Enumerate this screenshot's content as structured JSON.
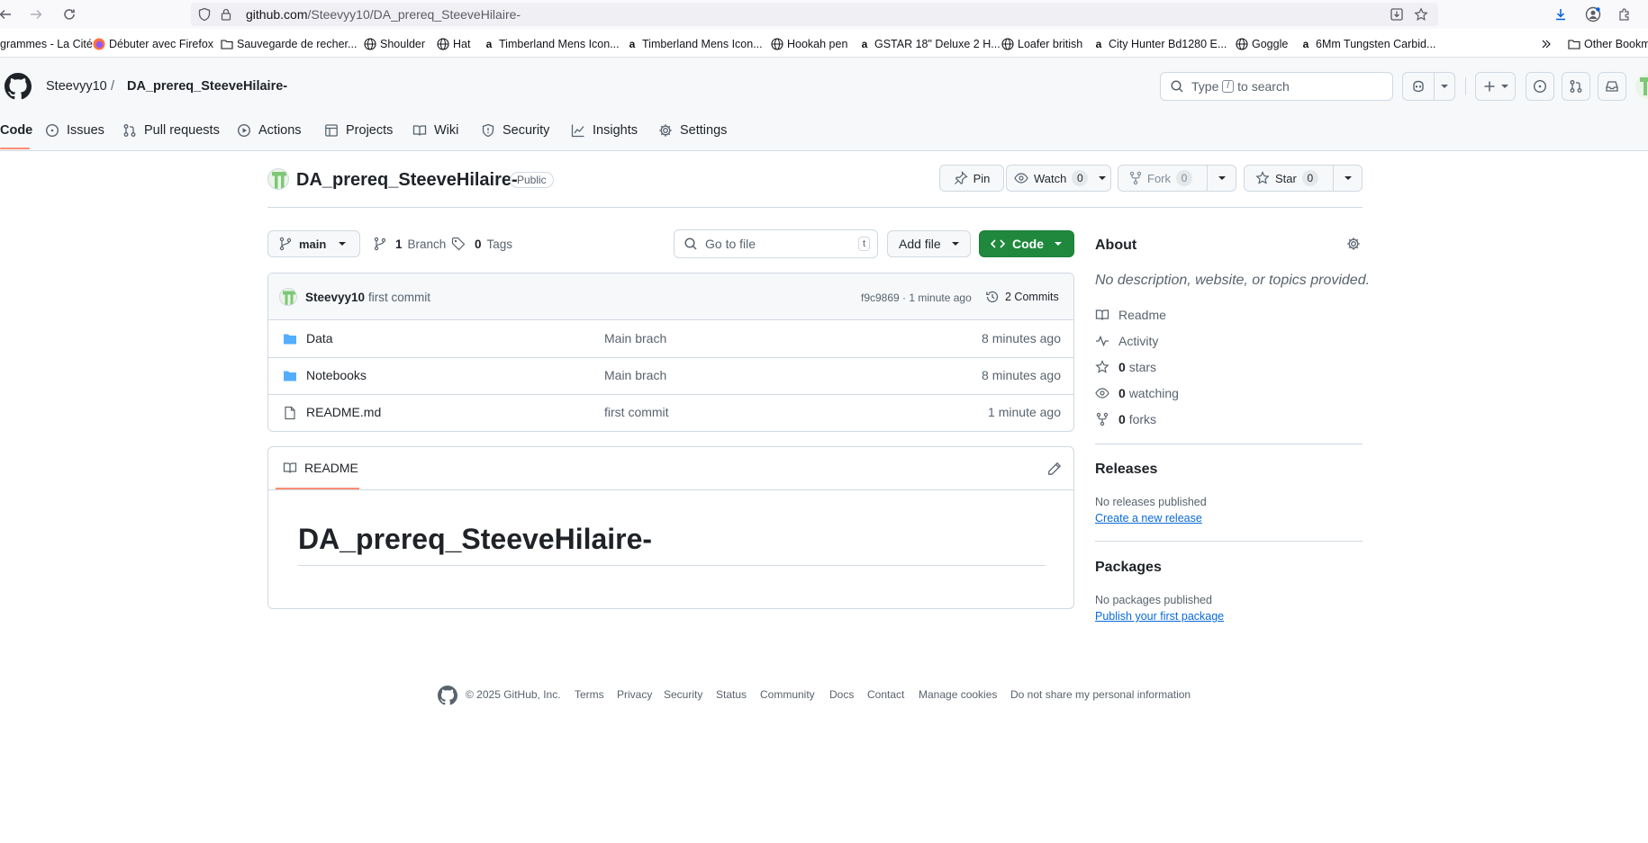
{
  "browser": {
    "url_host": "github.com",
    "url_path": "/Steevyy10/DA_prereq_SteeveHilaire-",
    "bookmarks": [
      "grammes - La Cité",
      "Débuter avec Firefox",
      "Sauvegarde de recher...",
      "Shoulder",
      "Hat",
      "Timberland Mens Icon...",
      "Timberland Mens Icon...",
      "Hookah pen",
      "GSTAR 18\" Deluxe 2 H...",
      "Loafer british",
      "City Hunter Bd1280 E...",
      "Goggle",
      "6Mm Tungsten Carbid..."
    ],
    "other_bookmarks": "Other Bookm"
  },
  "header": {
    "owner": "Steevyy10",
    "separator": "/",
    "repo": "DA_prereq_SteeveHilaire-",
    "search_prefix": "Type",
    "search_key": "/",
    "search_suffix": "to search"
  },
  "tabs": [
    "Code",
    "Issues",
    "Pull requests",
    "Actions",
    "Projects",
    "Wiki",
    "Security",
    "Insights",
    "Settings"
  ],
  "repo": {
    "name": "DA_prereq_SteeveHilaire-",
    "visibility": "Public",
    "pin_label": "Pin",
    "watch_label": "Watch",
    "watch_count": "0",
    "fork_label": "Fork",
    "fork_count": "0",
    "star_label": "Star",
    "star_count": "0"
  },
  "toolbar": {
    "branch": "main",
    "branch_count": "1",
    "branch_label": "Branch",
    "tag_count": "0",
    "tag_label": "Tags",
    "goto_placeholder": "Go to file",
    "goto_key": "t",
    "add_file": "Add file",
    "code": "Code"
  },
  "commit": {
    "author": "Steevyy10",
    "message": "first commit",
    "meta": "f9c9869 · 1 minute ago",
    "commits": "2 Commits"
  },
  "files": [
    {
      "name": "Data",
      "type": "folder",
      "message": "Main brach",
      "time": "8 minutes ago"
    },
    {
      "name": "Notebooks",
      "type": "folder",
      "message": "Main brach",
      "time": "8 minutes ago"
    },
    {
      "name": "README.md",
      "type": "file",
      "message": "first commit",
      "time": "1 minute ago"
    }
  ],
  "readme": {
    "tab": "README",
    "heading": "DA_prereq_SteeveHilaire-"
  },
  "about": {
    "title": "About",
    "description": "No description, website, or topics provided.",
    "readme": "Readme",
    "activity": "Activity",
    "stars_count": "0",
    "stars_label": "stars",
    "watching_count": "0",
    "watching_label": "watching",
    "forks_count": "0",
    "forks_label": "forks"
  },
  "releases": {
    "title": "Releases",
    "none": "No releases published",
    "create_link": "Create a new release"
  },
  "packages": {
    "title": "Packages",
    "none": "No packages published",
    "publish_link": "Publish your first package"
  },
  "footer": {
    "copyright": "© 2025 GitHub, Inc.",
    "links": [
      "Terms",
      "Privacy",
      "Security",
      "Status",
      "Community",
      "Docs",
      "Contact",
      "Manage cookies",
      "Do not share my personal information"
    ]
  },
  "colors": {
    "accent_green": "#1f883d",
    "link_blue": "#0969da",
    "folder_blue": "#54aeff",
    "tab_underline": "#fd8c73"
  }
}
